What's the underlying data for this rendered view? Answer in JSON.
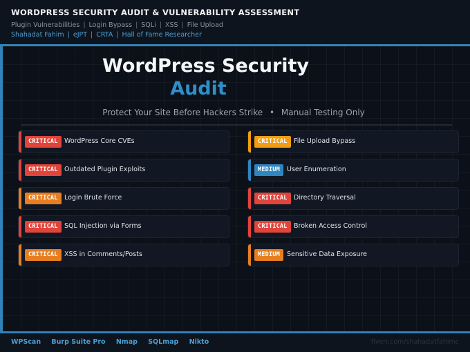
{
  "header": {
    "title": "WORDPRESS SECURITY AUDIT & VULNERABILITY ASSESSMENT",
    "skills": [
      "Plugin Vulnerabilities",
      "Login Bypass",
      "SQLi",
      "XSS",
      "File Upload"
    ],
    "credentials": [
      "Shahadat Fahim",
      "eJPT",
      "CRTA",
      "Hall of Fame Researcher"
    ]
  },
  "hero": {
    "line1": "WordPress Security",
    "line2": "Audit",
    "tagline_left": "Protect Your Site Before Hackers Strike",
    "tagline_bullet": "•",
    "tagline_right": "Manual Testing Only"
  },
  "colors": {
    "critical": "#e0443b",
    "critical_orange": "#e67e22",
    "medium": "#2e86c1",
    "accent": "#2f83b8"
  },
  "findings_left": [
    {
      "severity": "CRITICAL",
      "label": "WordPress Core CVEs",
      "color": "#e0443b"
    },
    {
      "severity": "CRITICAL",
      "label": "Outdated Plugin Exploits",
      "color": "#e0443b"
    },
    {
      "severity": "CRITICAL",
      "label": "Login Brute Force",
      "color": "#e67e22"
    },
    {
      "severity": "CRITICAL",
      "label": "SQL Injection via Forms",
      "color": "#e0443b"
    },
    {
      "severity": "CRITICAL",
      "label": "XSS in Comments/Posts",
      "color": "#e67e22"
    }
  ],
  "findings_right": [
    {
      "severity": "CRITICAL",
      "label": "File Upload Bypass",
      "color": "#f39c12"
    },
    {
      "severity": "MEDIUM",
      "label": "User Enumeration",
      "color": "#2e86c1"
    },
    {
      "severity": "CRITICAL",
      "label": "Directory Traversal",
      "color": "#e0443b"
    },
    {
      "severity": "CRITICAL",
      "label": "Broken Access Control",
      "color": "#e0443b"
    },
    {
      "severity": "MEDIUM",
      "label": "Sensitive Data Exposure",
      "color": "#e67e22"
    }
  ],
  "footer": {
    "tools": [
      "WPScan",
      "Burp Suite Pro",
      "Nmap",
      "SQLmap",
      "Nikto"
    ],
    "handle": "fiverr.com/shahadatfahimc"
  }
}
